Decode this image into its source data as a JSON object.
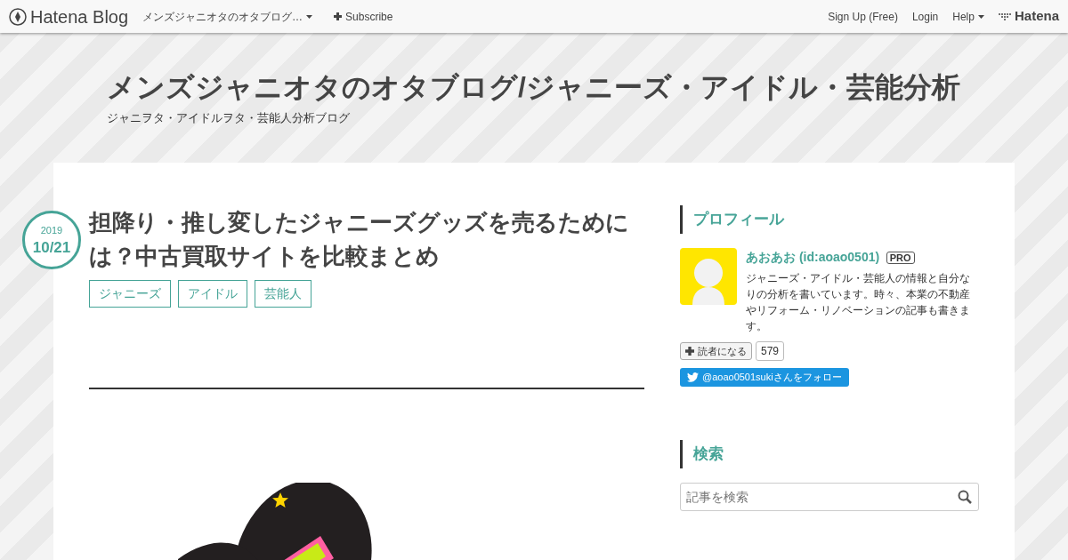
{
  "navbar": {
    "brand": "Hatena Blog",
    "blog_menu": "メンズジャニオタのオタブログ…",
    "subscribe": "Subscribe",
    "links": [
      "Sign Up (Free)",
      "Login"
    ],
    "help": "Help",
    "hatena": "Hatena"
  },
  "header": {
    "title": "メンズジャニオタのオタブログ/ジャニーズ・アイドル・芸能分析",
    "subtitle": "ジャニヲタ・アイドルヲタ・芸能人分析ブログ"
  },
  "entry": {
    "date_year": "2019",
    "date_day": "10/21",
    "title": "担降り・推し変したジャニーズグッズを売るためには？中古買取サイトを比較まとめ",
    "categories": [
      "ジャニーズ",
      "アイドル",
      "芸能人"
    ]
  },
  "sidebar": {
    "profile": {
      "heading": "プロフィール",
      "name": "あおあお (id:aoao0501)",
      "badge": "PRO",
      "description": "ジャニーズ・アイドル・芸能人の情報と自分なりの分析を書いています。時々、本業の不動産やリフォーム・リノベーションの記事も書きます。",
      "subscribe": "読者になる",
      "subscriber_count": "579",
      "twitter": "@aoao0501sukiさんをフォロー"
    },
    "search": {
      "heading": "検索",
      "placeholder": "記事を検索"
    }
  }
}
